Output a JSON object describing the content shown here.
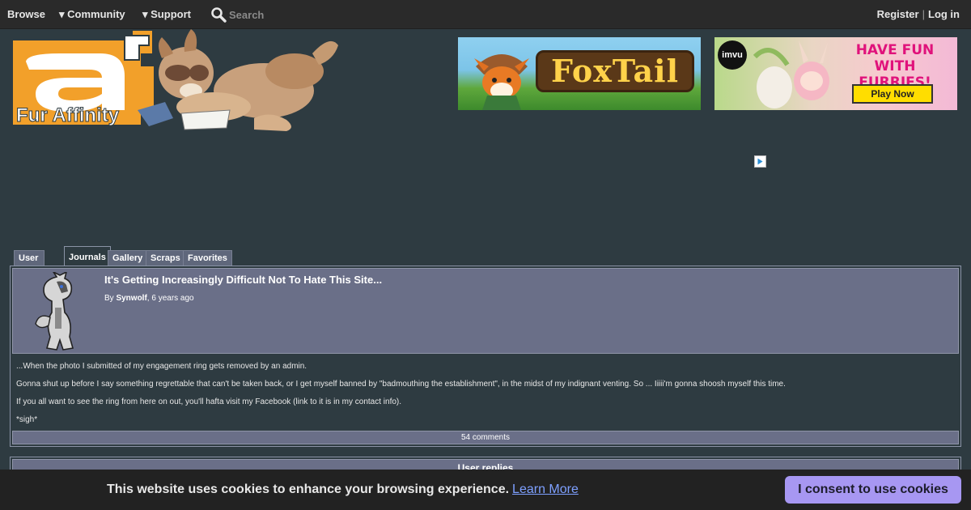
{
  "nav": {
    "browse": "Browse",
    "community": "▾ Community",
    "support": "▾ Support",
    "search_placeholder": "Search",
    "register": "Register",
    "separator": "|",
    "login": "Log in"
  },
  "logo": {
    "text": "Fur Affinity"
  },
  "ads": {
    "foxtail": {
      "text": "FoxTail"
    },
    "imvu": {
      "badge": "imvu",
      "title": "HAVE FUN WITH FURRIES!",
      "button": "Play Now"
    }
  },
  "tabs": [
    {
      "label": "User Page"
    },
    {
      "label": "Journals"
    },
    {
      "label": "Gallery"
    },
    {
      "label": "Scraps"
    },
    {
      "label": "Favorites"
    }
  ],
  "journal": {
    "title": "It's Getting Increasingly Difficult Not To Hate This Site...",
    "by": "By ",
    "author": "Synwolf",
    "time": ", 6 years ago",
    "paragraphs": [
      "...When the photo I submitted of my engagement ring gets removed by an admin.",
      "Gonna shut up before I say something regrettable that can't be taken back, or I get myself banned by \"badmouthing the establishment\", in the midst of my indignant venting. So ... Iiiii'm gonna shoosh myself this time.",
      "If you all want to see the ring from here on out, you'll hafta visit my Facebook (link to it is in my contact info).",
      "*sigh*"
    ],
    "comments": "54 comments"
  },
  "replies": {
    "header": "User replies"
  },
  "cookie": {
    "message": "This website uses cookies to enhance your browsing experience.",
    "learn_more": "Learn More",
    "consent": "I consent to use cookies"
  },
  "colors": {
    "background": "#2e3b41",
    "nav_bg": "#2a2a2a",
    "panel_header": "#6a6f88",
    "cookie_button": "#a797f2",
    "link": "#7ea0ff"
  }
}
